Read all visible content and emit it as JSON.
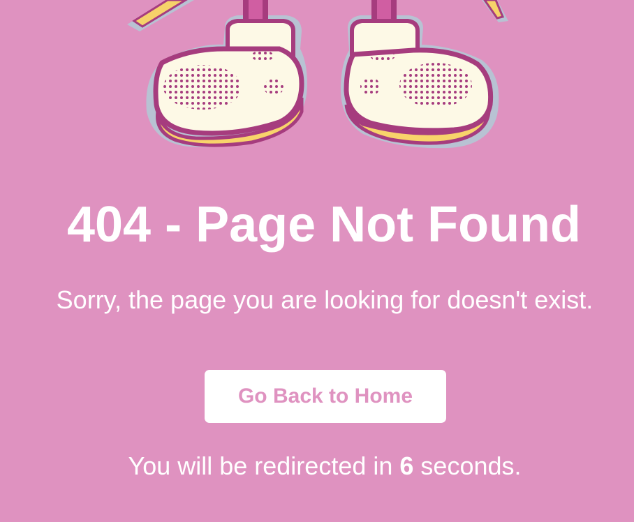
{
  "illustration": {
    "icon": "cartoon-feet-icon",
    "colors": {
      "outline": "#a63c7e",
      "shoe": "#fdf9e6",
      "sole": "#f8d36b",
      "halo": "#b8c2d3",
      "leg": "#d05ea2"
    }
  },
  "page": {
    "background": "#df92c0",
    "title": "404 - Page Not Found",
    "message": "Sorry, the page you are looking for doesn't exist.",
    "button_label": "Go Back to Home",
    "redirect": {
      "prefix": "You will be redirected in ",
      "seconds": "6",
      "suffix": " seconds."
    }
  }
}
